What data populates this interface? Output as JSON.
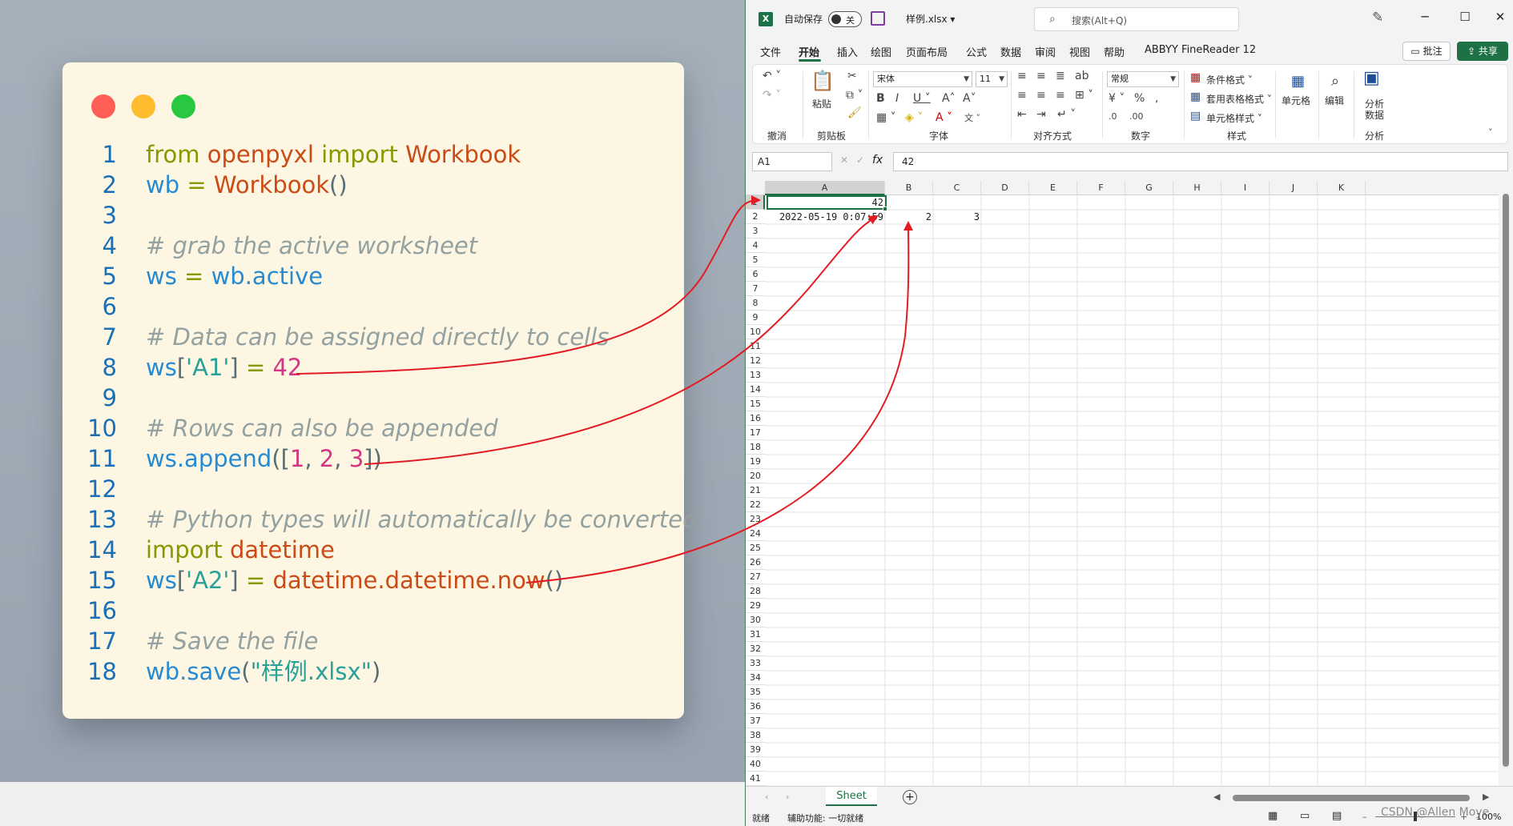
{
  "code": {
    "lines": [
      {
        "n": "1",
        "tokens": [
          {
            "t": "from ",
            "c": "kw"
          },
          {
            "t": "openpyxl ",
            "c": "fn"
          },
          {
            "t": "import ",
            "c": "kw"
          },
          {
            "t": "Workbook",
            "c": "fn"
          }
        ]
      },
      {
        "n": "2",
        "tokens": [
          {
            "t": "wb ",
            "c": "var"
          },
          {
            "t": "= ",
            "c": "op"
          },
          {
            "t": "Workbook",
            "c": "fn"
          },
          {
            "t": "()",
            "c": "pu"
          }
        ]
      },
      {
        "n": "3",
        "tokens": []
      },
      {
        "n": "4",
        "tokens": [
          {
            "t": "# grab the active worksheet",
            "c": "cm"
          }
        ]
      },
      {
        "n": "5",
        "tokens": [
          {
            "t": "ws ",
            "c": "var"
          },
          {
            "t": "= ",
            "c": "op"
          },
          {
            "t": "wb.active",
            "c": "var"
          }
        ]
      },
      {
        "n": "6",
        "tokens": []
      },
      {
        "n": "7",
        "tokens": [
          {
            "t": "# Data can be assigned directly to cells",
            "c": "cm"
          }
        ]
      },
      {
        "n": "8",
        "tokens": [
          {
            "t": "ws",
            "c": "var"
          },
          {
            "t": "[",
            "c": "pu"
          },
          {
            "t": "'A1'",
            "c": "str"
          },
          {
            "t": "] ",
            "c": "pu"
          },
          {
            "t": "= ",
            "c": "op"
          },
          {
            "t": "42",
            "c": "num"
          }
        ]
      },
      {
        "n": "9",
        "tokens": []
      },
      {
        "n": "10",
        "tokens": [
          {
            "t": "# Rows can also be appended",
            "c": "cm"
          }
        ]
      },
      {
        "n": "11",
        "tokens": [
          {
            "t": "ws.append",
            "c": "var"
          },
          {
            "t": "([",
            "c": "pu"
          },
          {
            "t": "1",
            "c": "num"
          },
          {
            "t": ", ",
            "c": "pu"
          },
          {
            "t": "2",
            "c": "num"
          },
          {
            "t": ", ",
            "c": "pu"
          },
          {
            "t": "3",
            "c": "num"
          },
          {
            "t": "])",
            "c": "pu"
          }
        ]
      },
      {
        "n": "12",
        "tokens": []
      },
      {
        "n": "13",
        "tokens": [
          {
            "t": "# Python types will automatically be converted",
            "c": "cm"
          }
        ]
      },
      {
        "n": "14",
        "tokens": [
          {
            "t": "import ",
            "c": "kw"
          },
          {
            "t": "datetime",
            "c": "fn"
          }
        ]
      },
      {
        "n": "15",
        "tokens": [
          {
            "t": "ws",
            "c": "var"
          },
          {
            "t": "[",
            "c": "pu"
          },
          {
            "t": "'A2'",
            "c": "str"
          },
          {
            "t": "] ",
            "c": "pu"
          },
          {
            "t": "= ",
            "c": "op"
          },
          {
            "t": "datetime.datetime.now",
            "c": "fn"
          },
          {
            "t": "()",
            "c": "pu"
          }
        ]
      },
      {
        "n": "16",
        "tokens": []
      },
      {
        "n": "17",
        "tokens": [
          {
            "t": "# Save the file",
            "c": "cm"
          }
        ]
      },
      {
        "n": "18",
        "tokens": [
          {
            "t": "wb.save",
            "c": "var"
          },
          {
            "t": "(",
            "c": "pu"
          },
          {
            "t": "\"样例.xlsx\"",
            "c": "str"
          },
          {
            "t": ")",
            "c": "pu"
          }
        ]
      }
    ]
  },
  "excel": {
    "logo": "X",
    "autosave_label": "自动保存",
    "autosave_state": "关",
    "filename": "样例.xlsx ▾",
    "search_placeholder": "搜索(Alt+Q)",
    "window_buttons": {
      "minimize": "─",
      "maximize": "☐",
      "close": "✕"
    },
    "menu_tabs": [
      "文件",
      "开始",
      "插入",
      "绘图",
      "页面布局",
      "公式",
      "数据",
      "审阅",
      "视图",
      "帮助",
      "ABBYY FineReader 12"
    ],
    "active_tab": "开始",
    "comments_label": "▭ 批注",
    "share_label": "⇪ 共享",
    "ribbon": {
      "groups": [
        "撤消",
        "剪贴板",
        "字体",
        "对齐方式",
        "数字",
        "样式",
        "",
        "",
        "分析"
      ],
      "paste": "粘贴",
      "font_name": "宋体",
      "font_size": "11",
      "number_format": "常规",
      "conditional_format": "条件格式 ˅",
      "table_format": "套用表格格式 ˅",
      "cell_style": "单元格样式 ˅",
      "cells": "单元格",
      "editing": "编辑",
      "analyze_line1": "分析",
      "analyze_line2": "数据"
    },
    "name_box": "A1",
    "formula_value": "42",
    "columns": [
      "A",
      "B",
      "C",
      "D",
      "E",
      "F",
      "G",
      "H",
      "I",
      "J",
      "K"
    ],
    "rows": [
      "1",
      "2",
      "3",
      "4",
      "5",
      "6",
      "7",
      "8",
      "9",
      "10",
      "11",
      "12",
      "13",
      "14",
      "15",
      "16",
      "17",
      "18",
      "19",
      "20",
      "21",
      "22",
      "23",
      "24",
      "25",
      "26",
      "27",
      "28",
      "29",
      "30",
      "31",
      "32",
      "33",
      "34",
      "35",
      "36",
      "37",
      "38",
      "39",
      "40",
      "41"
    ],
    "cells": {
      "A1": "42",
      "A2": "2022-05-19  0:07:59",
      "B2": "2",
      "C2": "3"
    },
    "sheet_tab": "Sheet",
    "status_ready": "就绪",
    "status_accessibility": "辅助功能: 一切就绪",
    "zoom": "100%"
  },
  "watermark": "CSDN @Allen Moye",
  "colors": {
    "accent": "#1e7145",
    "arrow": "#e31b23",
    "card_bg": "#fdf6e3"
  }
}
